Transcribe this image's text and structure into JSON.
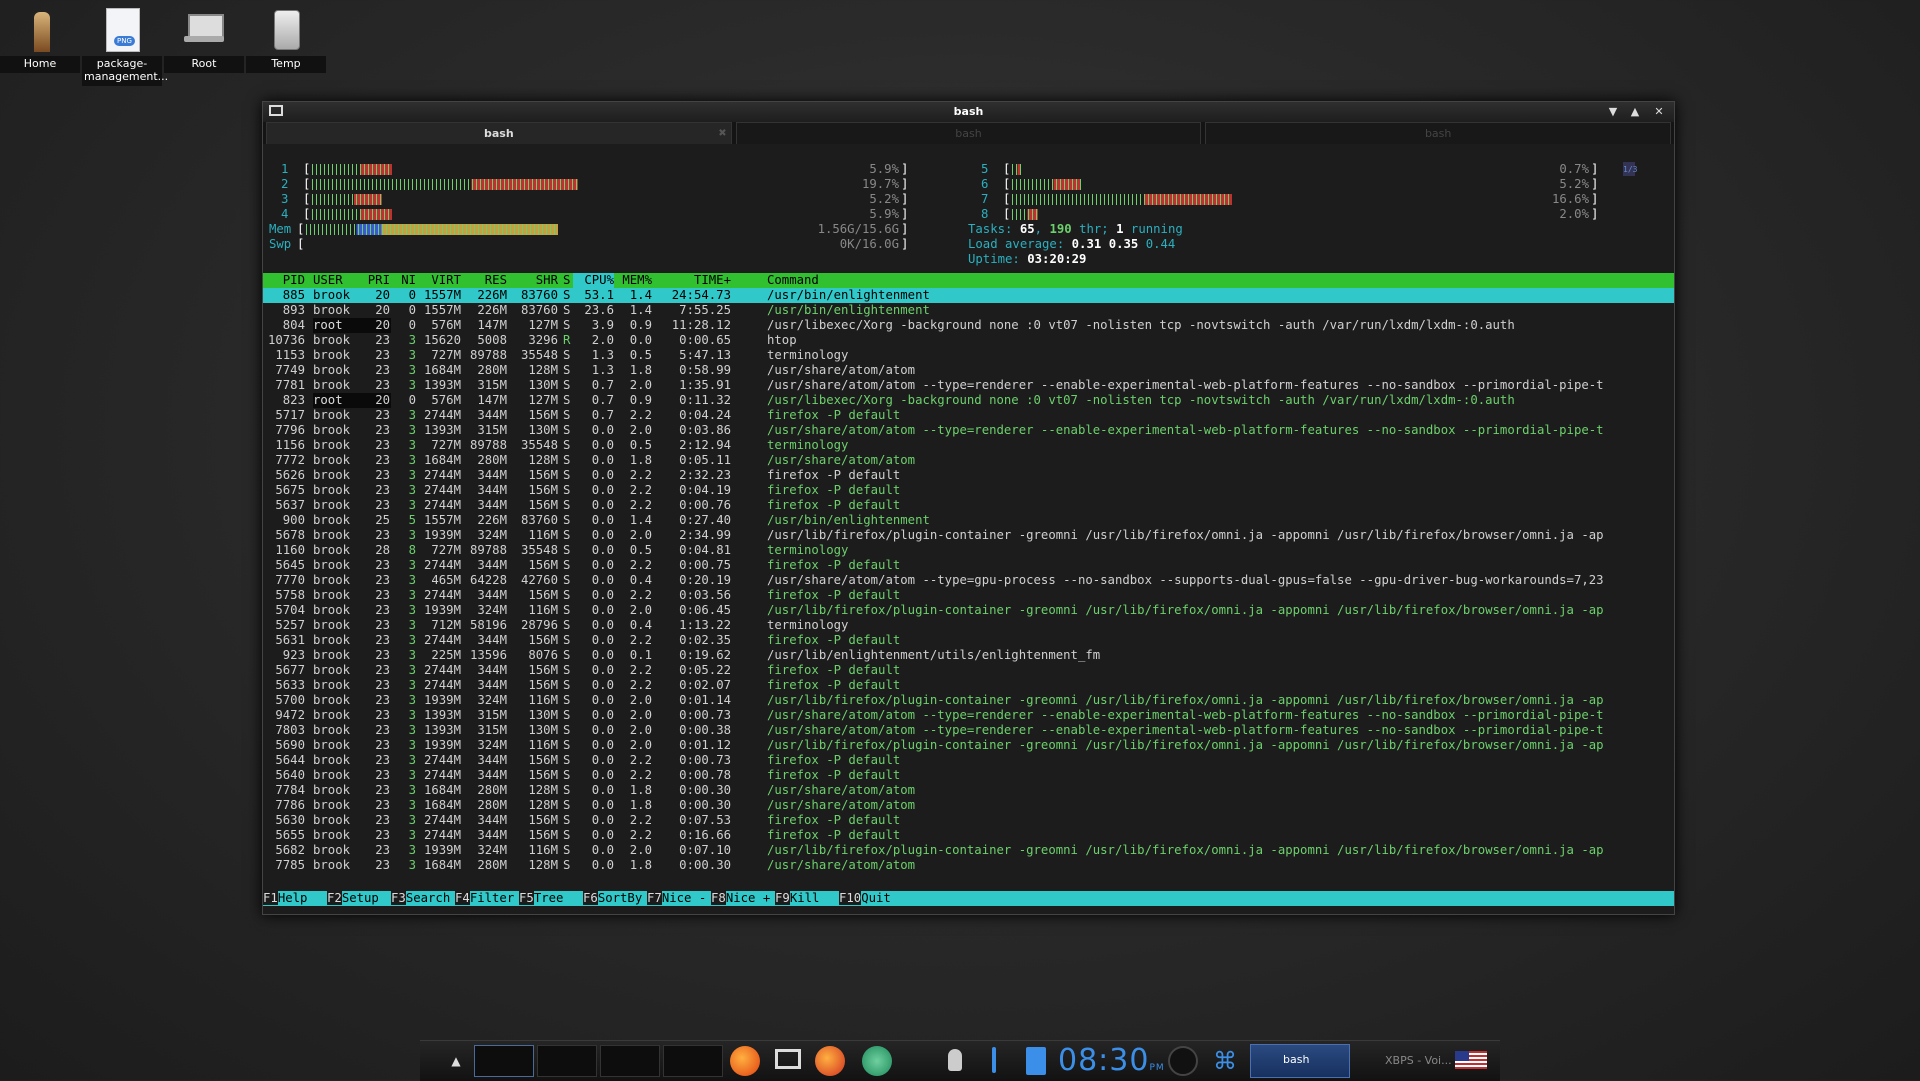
{
  "desktop": {
    "icons": [
      {
        "label": "Home"
      },
      {
        "label": "package-management..."
      },
      {
        "label": "Root"
      },
      {
        "label": "Temp"
      }
    ]
  },
  "window": {
    "title": "bash",
    "tabs": [
      {
        "label": "bash"
      },
      {
        "label": "bash"
      },
      {
        "label": "bash"
      }
    ]
  },
  "htop": {
    "cpu_meters": [
      {
        "num": "1",
        "percent": 5.9,
        "text": "5.9%"
      },
      {
        "num": "2",
        "percent": 19.7,
        "text": "19.7%"
      },
      {
        "num": "3",
        "percent": 5.2,
        "text": "5.2%"
      },
      {
        "num": "4",
        "percent": 5.9,
        "text": "5.9%"
      },
      {
        "num": "5",
        "percent": 0.7,
        "text": "0.7%"
      },
      {
        "num": "6",
        "percent": 5.2,
        "text": "5.2%"
      },
      {
        "num": "7",
        "percent": 16.6,
        "text": "16.6%"
      },
      {
        "num": "8",
        "percent": 2.0,
        "text": "2.0%"
      }
    ],
    "mem": {
      "label": "Mem",
      "text": "1.56G/15.6G",
      "fraction": 0.1
    },
    "swp": {
      "label": "Swp",
      "text": "0K/16.0G",
      "fraction": 0.0
    },
    "page_indicator": "1/3",
    "tasks_label": "Tasks:",
    "tasks_count": "65",
    "tasks_thr": "190",
    "tasks_thr_label": "thr;",
    "tasks_running": "1",
    "tasks_running_label": "running",
    "load_label": "Load average:",
    "load_1": "0.31",
    "load_5": "0.35",
    "load_15": "0.44",
    "uptime_label": "Uptime:",
    "uptime": "03:20:29",
    "columns": {
      "pid": "PID",
      "user": "USER",
      "pri": "PRI",
      "ni": "NI",
      "virt": "VIRT",
      "res": "RES",
      "shr": "SHR",
      "s": "S",
      "cpu": "CPU%",
      "mem": "MEM%",
      "time": "TIME+",
      "command": "Command"
    },
    "processes": [
      {
        "pid": "885",
        "user": "brook",
        "pri": "20",
        "ni": "0",
        "virt": "1557M",
        "res": "226M",
        "shr": "83760",
        "s": "S",
        "cpu": "53.1",
        "mem": "1.4",
        "time": "24:54.73",
        "cmd": "/usr/bin/enlightenment",
        "thread": false,
        "selected": true
      },
      {
        "pid": "893",
        "user": "brook",
        "pri": "20",
        "ni": "0",
        "virt": "1557M",
        "res": "226M",
        "shr": "83760",
        "s": "S",
        "cpu": "23.6",
        "mem": "1.4",
        "time": "7:55.25",
        "cmd": "/usr/bin/enlightenment",
        "thread": true
      },
      {
        "pid": "804",
        "user": "root",
        "pri": "20",
        "ni": "0",
        "virt": "576M",
        "res": "147M",
        "shr": "127M",
        "s": "S",
        "cpu": "3.9",
        "mem": "0.9",
        "time": "11:28.12",
        "cmd": "/usr/libexec/Xorg -background none :0 vt07 -nolisten tcp -novtswitch -auth /var/run/lxdm/lxdm-:0.auth",
        "thread": false
      },
      {
        "pid": "10736",
        "user": "brook",
        "pri": "23",
        "ni": "3",
        "virt": "15620",
        "res": "5008",
        "shr": "3296",
        "s": "R",
        "cpu": "2.0",
        "mem": "0.0",
        "time": "0:00.65",
        "cmd": "htop",
        "thread": false
      },
      {
        "pid": "1153",
        "user": "brook",
        "pri": "23",
        "ni": "3",
        "virt": "727M",
        "res": "89788",
        "shr": "35548",
        "s": "S",
        "cpu": "1.3",
        "mem": "0.5",
        "time": "5:47.13",
        "cmd": "terminology",
        "thread": false
      },
      {
        "pid": "7749",
        "user": "brook",
        "pri": "23",
        "ni": "3",
        "virt": "1684M",
        "res": "280M",
        "shr": "128M",
        "s": "S",
        "cpu": "1.3",
        "mem": "1.8",
        "time": "0:58.99",
        "cmd": "/usr/share/atom/atom",
        "thread": false
      },
      {
        "pid": "7781",
        "user": "brook",
        "pri": "23",
        "ni": "3",
        "virt": "1393M",
        "res": "315M",
        "shr": "130M",
        "s": "S",
        "cpu": "0.7",
        "mem": "2.0",
        "time": "1:35.91",
        "cmd": "/usr/share/atom/atom --type=renderer --enable-experimental-web-platform-features --no-sandbox --primordial-pipe-t",
        "thread": false
      },
      {
        "pid": "823",
        "user": "root",
        "pri": "20",
        "ni": "0",
        "virt": "576M",
        "res": "147M",
        "shr": "127M",
        "s": "S",
        "cpu": "0.7",
        "mem": "0.9",
        "time": "0:11.32",
        "cmd": "/usr/libexec/Xorg -background none :0 vt07 -nolisten tcp -novtswitch -auth /var/run/lxdm/lxdm-:0.auth",
        "thread": true
      },
      {
        "pid": "5717",
        "user": "brook",
        "pri": "23",
        "ni": "3",
        "virt": "2744M",
        "res": "344M",
        "shr": "156M",
        "s": "S",
        "cpu": "0.7",
        "mem": "2.2",
        "time": "0:04.24",
        "cmd": "firefox -P default",
        "thread": true
      },
      {
        "pid": "7796",
        "user": "brook",
        "pri": "23",
        "ni": "3",
        "virt": "1393M",
        "res": "315M",
        "shr": "130M",
        "s": "S",
        "cpu": "0.0",
        "mem": "2.0",
        "time": "0:03.86",
        "cmd": "/usr/share/atom/atom --type=renderer --enable-experimental-web-platform-features --no-sandbox --primordial-pipe-t",
        "thread": true
      },
      {
        "pid": "1156",
        "user": "brook",
        "pri": "23",
        "ni": "3",
        "virt": "727M",
        "res": "89788",
        "shr": "35548",
        "s": "S",
        "cpu": "0.0",
        "mem": "0.5",
        "time": "2:12.94",
        "cmd": "terminology",
        "thread": true
      },
      {
        "pid": "7772",
        "user": "brook",
        "pri": "23",
        "ni": "3",
        "virt": "1684M",
        "res": "280M",
        "shr": "128M",
        "s": "S",
        "cpu": "0.0",
        "mem": "1.8",
        "time": "0:05.11",
        "cmd": "/usr/share/atom/atom",
        "thread": true
      },
      {
        "pid": "5626",
        "user": "brook",
        "pri": "23",
        "ni": "3",
        "virt": "2744M",
        "res": "344M",
        "shr": "156M",
        "s": "S",
        "cpu": "0.0",
        "mem": "2.2",
        "time": "2:32.23",
        "cmd": "firefox -P default",
        "thread": false
      },
      {
        "pid": "5675",
        "user": "brook",
        "pri": "23",
        "ni": "3",
        "virt": "2744M",
        "res": "344M",
        "shr": "156M",
        "s": "S",
        "cpu": "0.0",
        "mem": "2.2",
        "time": "0:04.19",
        "cmd": "firefox -P default",
        "thread": true
      },
      {
        "pid": "5637",
        "user": "brook",
        "pri": "23",
        "ni": "3",
        "virt": "2744M",
        "res": "344M",
        "shr": "156M",
        "s": "S",
        "cpu": "0.0",
        "mem": "2.2",
        "time": "0:00.76",
        "cmd": "firefox -P default",
        "thread": true
      },
      {
        "pid": "900",
        "user": "brook",
        "pri": "25",
        "ni": "5",
        "virt": "1557M",
        "res": "226M",
        "shr": "83760",
        "s": "S",
        "cpu": "0.0",
        "mem": "1.4",
        "time": "0:27.40",
        "cmd": "/usr/bin/enlightenment",
        "thread": true
      },
      {
        "pid": "5678",
        "user": "brook",
        "pri": "23",
        "ni": "3",
        "virt": "1939M",
        "res": "324M",
        "shr": "116M",
        "s": "S",
        "cpu": "0.0",
        "mem": "2.0",
        "time": "2:34.99",
        "cmd": "/usr/lib/firefox/plugin-container -greomni /usr/lib/firefox/omni.ja -appomni /usr/lib/firefox/browser/omni.ja -ap",
        "thread": false
      },
      {
        "pid": "1160",
        "user": "brook",
        "pri": "28",
        "ni": "8",
        "virt": "727M",
        "res": "89788",
        "shr": "35548",
        "s": "S",
        "cpu": "0.0",
        "mem": "0.5",
        "time": "0:04.81",
        "cmd": "terminology",
        "thread": true
      },
      {
        "pid": "5645",
        "user": "brook",
        "pri": "23",
        "ni": "3",
        "virt": "2744M",
        "res": "344M",
        "shr": "156M",
        "s": "S",
        "cpu": "0.0",
        "mem": "2.2",
        "time": "0:00.75",
        "cmd": "firefox -P default",
        "thread": true
      },
      {
        "pid": "7770",
        "user": "brook",
        "pri": "23",
        "ni": "3",
        "virt": "465M",
        "res": "64228",
        "shr": "42760",
        "s": "S",
        "cpu": "0.0",
        "mem": "0.4",
        "time": "0:20.19",
        "cmd": "/usr/share/atom/atom --type=gpu-process --no-sandbox --supports-dual-gpus=false --gpu-driver-bug-workarounds=7,23",
        "thread": false
      },
      {
        "pid": "5758",
        "user": "brook",
        "pri": "23",
        "ni": "3",
        "virt": "2744M",
        "res": "344M",
        "shr": "156M",
        "s": "S",
        "cpu": "0.0",
        "mem": "2.2",
        "time": "0:03.56",
        "cmd": "firefox -P default",
        "thread": true
      },
      {
        "pid": "5704",
        "user": "brook",
        "pri": "23",
        "ni": "3",
        "virt": "1939M",
        "res": "324M",
        "shr": "116M",
        "s": "S",
        "cpu": "0.0",
        "mem": "2.0",
        "time": "0:06.45",
        "cmd": "/usr/lib/firefox/plugin-container -greomni /usr/lib/firefox/omni.ja -appomni /usr/lib/firefox/browser/omni.ja -ap",
        "thread": true
      },
      {
        "pid": "5257",
        "user": "brook",
        "pri": "23",
        "ni": "3",
        "virt": "712M",
        "res": "58196",
        "shr": "28796",
        "s": "S",
        "cpu": "0.0",
        "mem": "0.4",
        "time": "1:13.22",
        "cmd": "terminology",
        "thread": false
      },
      {
        "pid": "5631",
        "user": "brook",
        "pri": "23",
        "ni": "3",
        "virt": "2744M",
        "res": "344M",
        "shr": "156M",
        "s": "S",
        "cpu": "0.0",
        "mem": "2.2",
        "time": "0:02.35",
        "cmd": "firefox -P default",
        "thread": true
      },
      {
        "pid": "923",
        "user": "brook",
        "pri": "23",
        "ni": "3",
        "virt": "225M",
        "res": "13596",
        "shr": "8076",
        "s": "S",
        "cpu": "0.0",
        "mem": "0.1",
        "time": "0:19.62",
        "cmd": "/usr/lib/enlightenment/utils/enlightenment_fm",
        "thread": false
      },
      {
        "pid": "5677",
        "user": "brook",
        "pri": "23",
        "ni": "3",
        "virt": "2744M",
        "res": "344M",
        "shr": "156M",
        "s": "S",
        "cpu": "0.0",
        "mem": "2.2",
        "time": "0:05.22",
        "cmd": "firefox -P default",
        "thread": true
      },
      {
        "pid": "5633",
        "user": "brook",
        "pri": "23",
        "ni": "3",
        "virt": "2744M",
        "res": "344M",
        "shr": "156M",
        "s": "S",
        "cpu": "0.0",
        "mem": "2.2",
        "time": "0:02.07",
        "cmd": "firefox -P default",
        "thread": true
      },
      {
        "pid": "5700",
        "user": "brook",
        "pri": "23",
        "ni": "3",
        "virt": "1939M",
        "res": "324M",
        "shr": "116M",
        "s": "S",
        "cpu": "0.0",
        "mem": "2.0",
        "time": "0:01.14",
        "cmd": "/usr/lib/firefox/plugin-container -greomni /usr/lib/firefox/omni.ja -appomni /usr/lib/firefox/browser/omni.ja -ap",
        "thread": true
      },
      {
        "pid": "9472",
        "user": "brook",
        "pri": "23",
        "ni": "3",
        "virt": "1393M",
        "res": "315M",
        "shr": "130M",
        "s": "S",
        "cpu": "0.0",
        "mem": "2.0",
        "time": "0:00.73",
        "cmd": "/usr/share/atom/atom --type=renderer --enable-experimental-web-platform-features --no-sandbox --primordial-pipe-t",
        "thread": true
      },
      {
        "pid": "7803",
        "user": "brook",
        "pri": "23",
        "ni": "3",
        "virt": "1393M",
        "res": "315M",
        "shr": "130M",
        "s": "S",
        "cpu": "0.0",
        "mem": "2.0",
        "time": "0:00.38",
        "cmd": "/usr/share/atom/atom --type=renderer --enable-experimental-web-platform-features --no-sandbox --primordial-pipe-t",
        "thread": true
      },
      {
        "pid": "5690",
        "user": "brook",
        "pri": "23",
        "ni": "3",
        "virt": "1939M",
        "res": "324M",
        "shr": "116M",
        "s": "S",
        "cpu": "0.0",
        "mem": "2.0",
        "time": "0:01.12",
        "cmd": "/usr/lib/firefox/plugin-container -greomni /usr/lib/firefox/omni.ja -appomni /usr/lib/firefox/browser/omni.ja -ap",
        "thread": true
      },
      {
        "pid": "5644",
        "user": "brook",
        "pri": "23",
        "ni": "3",
        "virt": "2744M",
        "res": "344M",
        "shr": "156M",
        "s": "S",
        "cpu": "0.0",
        "mem": "2.2",
        "time": "0:00.73",
        "cmd": "firefox -P default",
        "thread": true
      },
      {
        "pid": "5640",
        "user": "brook",
        "pri": "23",
        "ni": "3",
        "virt": "2744M",
        "res": "344M",
        "shr": "156M",
        "s": "S",
        "cpu": "0.0",
        "mem": "2.2",
        "time": "0:00.78",
        "cmd": "firefox -P default",
        "thread": true
      },
      {
        "pid": "7784",
        "user": "brook",
        "pri": "23",
        "ni": "3",
        "virt": "1684M",
        "res": "280M",
        "shr": "128M",
        "s": "S",
        "cpu": "0.0",
        "mem": "1.8",
        "time": "0:00.30",
        "cmd": "/usr/share/atom/atom",
        "thread": true
      },
      {
        "pid": "7786",
        "user": "brook",
        "pri": "23",
        "ni": "3",
        "virt": "1684M",
        "res": "280M",
        "shr": "128M",
        "s": "S",
        "cpu": "0.0",
        "mem": "1.8",
        "time": "0:00.30",
        "cmd": "/usr/share/atom/atom",
        "thread": true
      },
      {
        "pid": "5630",
        "user": "brook",
        "pri": "23",
        "ni": "3",
        "virt": "2744M",
        "res": "344M",
        "shr": "156M",
        "s": "S",
        "cpu": "0.0",
        "mem": "2.2",
        "time": "0:07.53",
        "cmd": "firefox -P default",
        "thread": true
      },
      {
        "pid": "5655",
        "user": "brook",
        "pri": "23",
        "ni": "3",
        "virt": "2744M",
        "res": "344M",
        "shr": "156M",
        "s": "S",
        "cpu": "0.0",
        "mem": "2.2",
        "time": "0:16.66",
        "cmd": "firefox -P default",
        "thread": true
      },
      {
        "pid": "5682",
        "user": "brook",
        "pri": "23",
        "ni": "3",
        "virt": "1939M",
        "res": "324M",
        "shr": "116M",
        "s": "S",
        "cpu": "0.0",
        "mem": "2.0",
        "time": "0:07.10",
        "cmd": "/usr/lib/firefox/plugin-container -greomni /usr/lib/firefox/omni.ja -appomni /usr/lib/firefox/browser/omni.ja -ap",
        "thread": true
      },
      {
        "pid": "7785",
        "user": "brook",
        "pri": "23",
        "ni": "3",
        "virt": "1684M",
        "res": "280M",
        "shr": "128M",
        "s": "S",
        "cpu": "0.0",
        "mem": "1.8",
        "time": "0:00.30",
        "cmd": "/usr/share/atom/atom",
        "thread": true
      }
    ],
    "fkeys": [
      {
        "key": "F1",
        "label": "Help"
      },
      {
        "key": "F2",
        "label": "Setup"
      },
      {
        "key": "F3",
        "label": "Search"
      },
      {
        "key": "F4",
        "label": "Filter"
      },
      {
        "key": "F5",
        "label": "Tree"
      },
      {
        "key": "F6",
        "label": "SortBy"
      },
      {
        "key": "F7",
        "label": "Nice -"
      },
      {
        "key": "F8",
        "label": "Nice +"
      },
      {
        "key": "F9",
        "label": "Kill"
      },
      {
        "key": "F10",
        "label": "Quit"
      }
    ]
  },
  "taskbar": {
    "clock": "08:30",
    "clock_suffix": "PM",
    "tasks": [
      {
        "label": "bash",
        "active": true
      },
      {
        "label": "XBPS - Voi...",
        "active": false
      }
    ],
    "icons": [
      "firefox-icon",
      "terminal-icon",
      "firefox-icon",
      "network-icon",
      "lightbulb-icon",
      "thermometer-icon",
      "clipboard-icon",
      "moon-icon",
      "wifi-icon",
      "flag-icon"
    ]
  },
  "colors": {
    "accent_cyan": "#30c8c8",
    "header_green": "#30c030",
    "clock_blue": "#3b8fe8"
  }
}
